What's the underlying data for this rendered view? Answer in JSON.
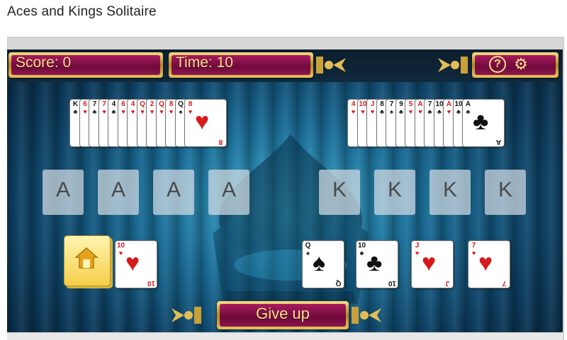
{
  "page": {
    "title": "Aces and Kings Solitaire"
  },
  "hud": {
    "score_label": "Score: 0",
    "time_label": "Time: 10",
    "help_icon": "?",
    "gear_icon": "⚙"
  },
  "colors": {
    "felt": "#1a6f9a",
    "plaque": "#8e1550",
    "gold": "#f7e08a"
  },
  "aces_pile": {
    "fan": [
      {
        "rank": "K",
        "suit": "♣",
        "color": "black"
      },
      {
        "rank": "6",
        "suit": "♥",
        "color": "red"
      },
      {
        "rank": "7",
        "suit": "♣",
        "color": "black"
      },
      {
        "rank": "7",
        "suit": "♥",
        "color": "red"
      },
      {
        "rank": "4",
        "suit": "♣",
        "color": "black"
      },
      {
        "rank": "6",
        "suit": "♥",
        "color": "red"
      },
      {
        "rank": "4",
        "suit": "♥",
        "color": "red"
      },
      {
        "rank": "Q",
        "suit": "♥",
        "color": "red"
      },
      {
        "rank": "2",
        "suit": "♥",
        "color": "red"
      },
      {
        "rank": "Q",
        "suit": "♥",
        "color": "red"
      },
      {
        "rank": "8",
        "suit": "♥",
        "color": "red"
      },
      {
        "rank": "Q",
        "suit": "♠",
        "color": "black"
      }
    ],
    "top": {
      "rank": "8",
      "suit": "♥",
      "color": "red"
    }
  },
  "kings_pile": {
    "fan": [
      {
        "rank": "4",
        "suit": "♥",
        "color": "red"
      },
      {
        "rank": "10",
        "suit": "♥",
        "color": "red"
      },
      {
        "rank": "J",
        "suit": "♥",
        "color": "red"
      },
      {
        "rank": "8",
        "suit": "♣",
        "color": "black"
      },
      {
        "rank": "7",
        "suit": "♠",
        "color": "black"
      },
      {
        "rank": "9",
        "suit": "♣",
        "color": "black"
      },
      {
        "rank": "5",
        "suit": "♥",
        "color": "red"
      },
      {
        "rank": "A",
        "suit": "♥",
        "color": "red"
      },
      {
        "rank": "7",
        "suit": "♣",
        "color": "black"
      },
      {
        "rank": "10",
        "suit": "♣",
        "color": "black"
      },
      {
        "rank": "A",
        "suit": "♥",
        "color": "red"
      },
      {
        "rank": "10",
        "suit": "♣",
        "color": "black"
      }
    ],
    "top": {
      "rank": "A",
      "suit": "♣",
      "color": "black"
    }
  },
  "foundations": [
    "A",
    "A",
    "A",
    "A",
    "K",
    "K",
    "K",
    "K"
  ],
  "waste": {
    "rank": "10",
    "suit": "♥",
    "color": "red"
  },
  "tableau": [
    {
      "rank": "Q",
      "suit": "♠",
      "color": "black"
    },
    {
      "rank": "10",
      "suit": "♣",
      "color": "black"
    },
    {
      "rank": "J",
      "suit": "♥",
      "color": "red"
    },
    {
      "rank": "7",
      "suit": "♥",
      "color": "red"
    }
  ],
  "actions": {
    "give_up_label": "Give up"
  }
}
